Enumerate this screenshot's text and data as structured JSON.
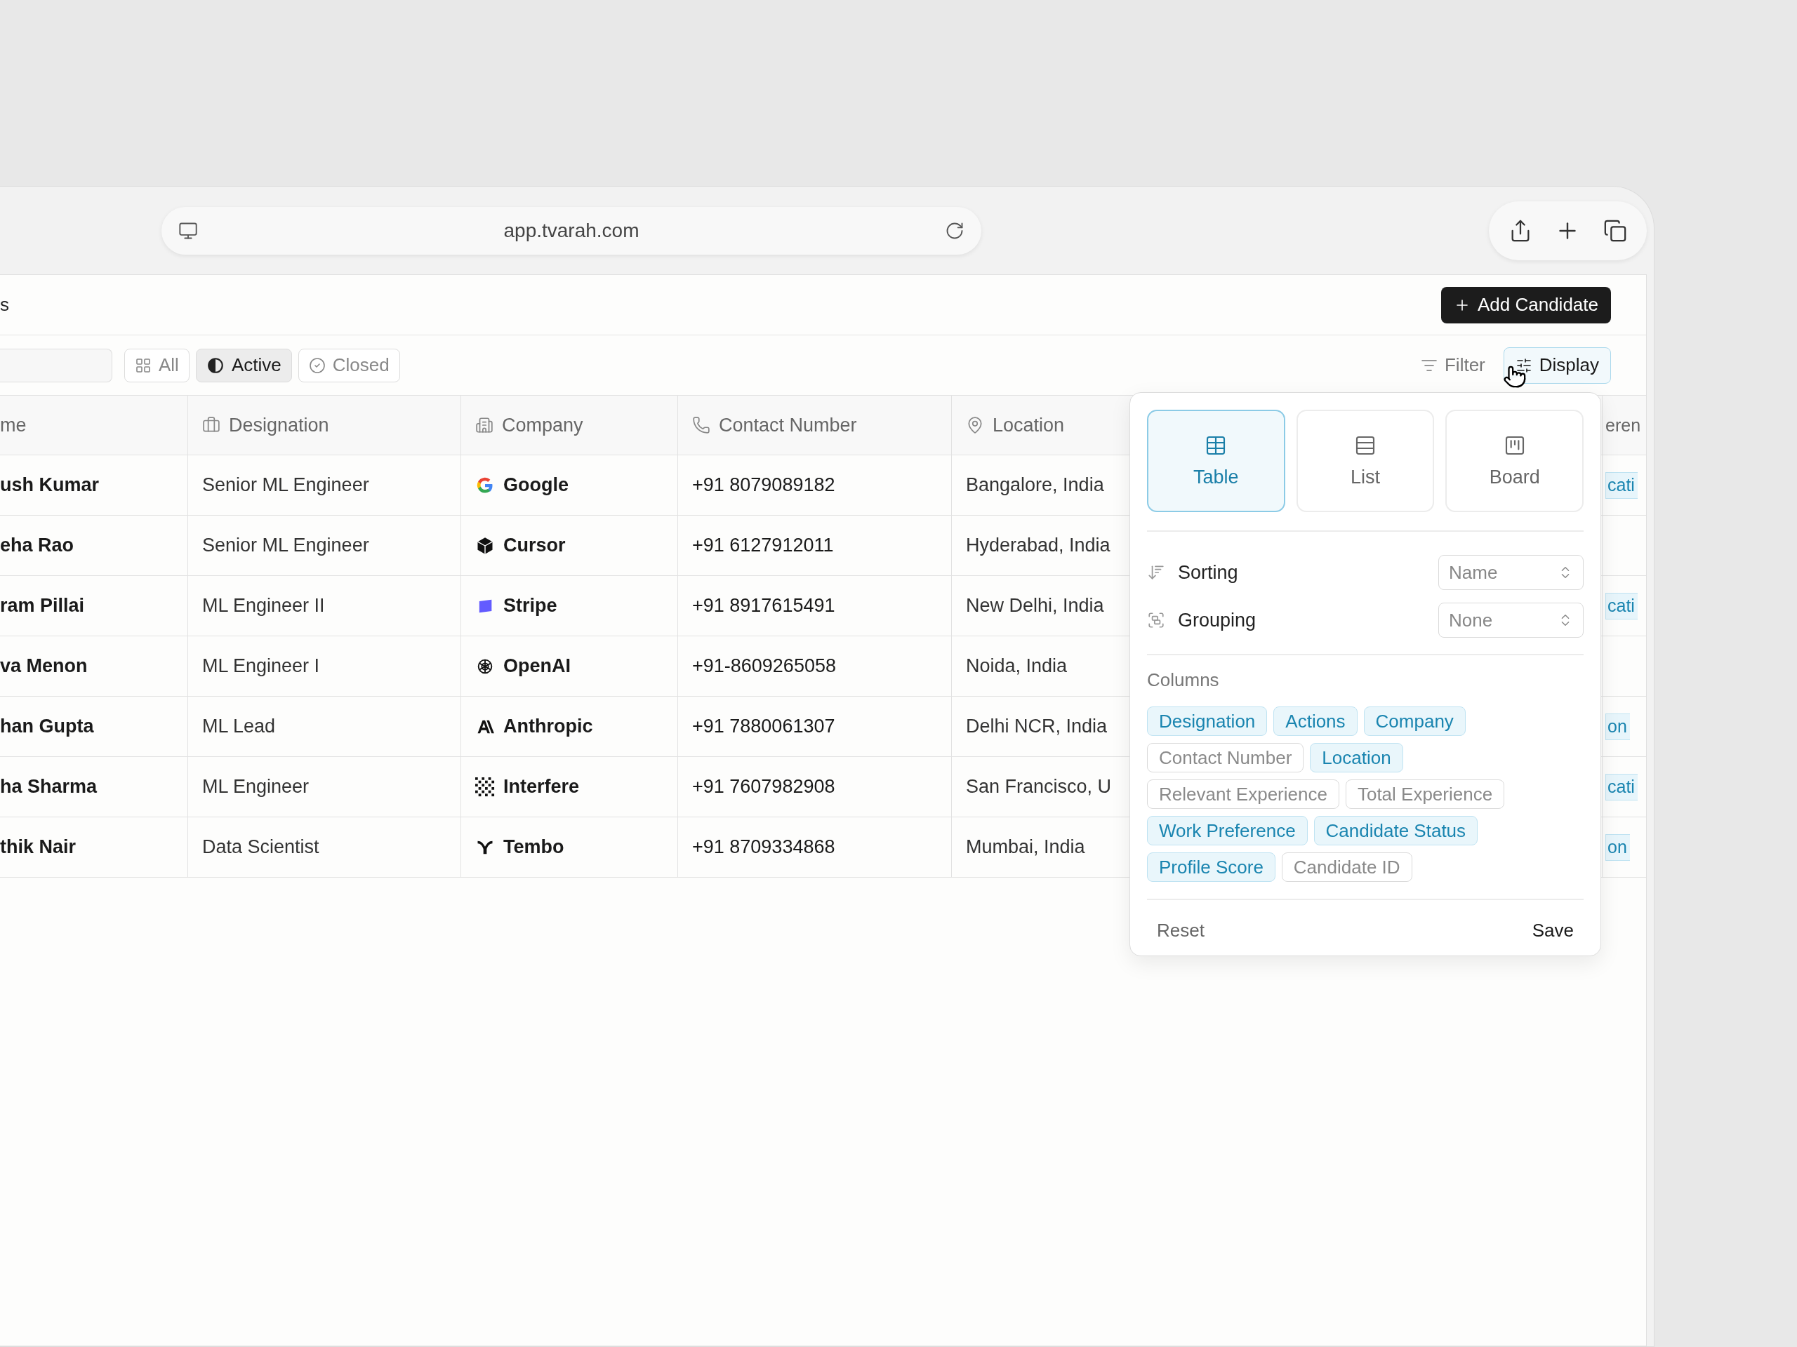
{
  "browser": {
    "url": "app.tvarah.com"
  },
  "page": {
    "title": "s",
    "primary_action": "Add Candidate"
  },
  "status_tabs": [
    {
      "label": "All",
      "selected": false
    },
    {
      "label": "Active",
      "selected": true
    },
    {
      "label": "Closed",
      "selected": false
    }
  ],
  "view_buttons": [
    {
      "label": "Filter",
      "selected": false
    },
    {
      "label": "Display",
      "selected": true
    }
  ],
  "table": {
    "columns": [
      "me",
      "Designation",
      "Company",
      "Contact Number",
      "Location",
      "eren"
    ],
    "rows": [
      {
        "name": "ush Kumar",
        "designation": "Senior ML Engineer",
        "company": "Google",
        "contact": "+91 8079089182",
        "location": "Bangalore, India",
        "column_6": "cati"
      },
      {
        "name": "eha Rao",
        "designation": "Senior ML Engineer",
        "company": "Cursor",
        "contact": "+91 6127912011",
        "location": "Hyderabad, India"
      },
      {
        "name": "ram Pillai",
        "designation": "ML Engineer II",
        "company": "Stripe",
        "contact": "+91 8917615491",
        "location": "New Delhi, India",
        "column_6": "cati"
      },
      {
        "name": "va Menon",
        "designation": "ML Engineer I",
        "company": "OpenAI",
        "contact": "+91-8609265058",
        "location": "Noida, India"
      },
      {
        "name": "han Gupta",
        "designation": "ML Lead",
        "company": "Anthropic",
        "contact": "+91 7880061307",
        "location": "Delhi NCR, India",
        "column_6": "on"
      },
      {
        "name": "ha Sharma",
        "designation": "ML Engineer",
        "company": "Interfere",
        "contact": "+91 7607982908",
        "location": "San Francisco, U",
        "column_6": "cati"
      },
      {
        "name": "thik Nair",
        "designation": "Data Scientist",
        "company": "Tembo",
        "contact": "+91 8709334868",
        "location": "Mumbai, India",
        "column_6": "on"
      }
    ]
  },
  "display_panel": {
    "views": [
      {
        "label": "Table",
        "selected": true
      },
      {
        "label": "List",
        "selected": false
      },
      {
        "label": "Board",
        "selected": false
      }
    ],
    "sorting": {
      "label": "Sorting",
      "value": "Name"
    },
    "grouping": {
      "label": "Grouping",
      "value": "None"
    },
    "columns_label": "Columns",
    "columns": [
      {
        "label": "Designation",
        "on": true
      },
      {
        "label": "Actions",
        "on": true
      },
      {
        "label": "Company",
        "on": true
      },
      {
        "label": "Contact Number",
        "on": false
      },
      {
        "label": "Location",
        "on": true
      },
      {
        "label": "Relevant Experience",
        "on": false
      },
      {
        "label": "Total Experience",
        "on": false
      },
      {
        "label": "Work Preference",
        "on": true
      },
      {
        "label": "Candidate Status",
        "on": true
      },
      {
        "label": "Profile Score",
        "on": true
      },
      {
        "label": "Candidate ID",
        "on": false
      }
    ],
    "reset": "Reset",
    "save": "Save"
  }
}
